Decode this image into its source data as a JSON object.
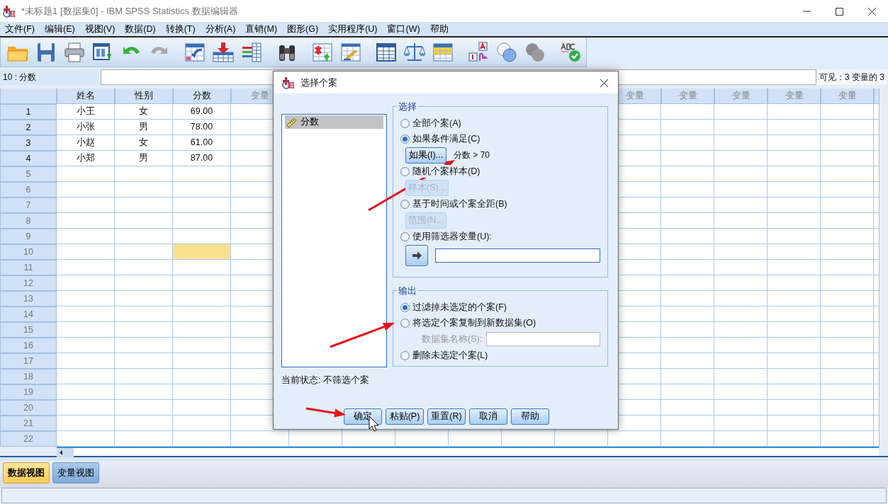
{
  "window": {
    "title": "*未标题1 [数据集0] - IBM SPSS Statistics 数据编辑器"
  },
  "menu": [
    "文件(F)",
    "编辑(E)",
    "视图(V)",
    "数据(D)",
    "转换(T)",
    "分析(A)",
    "直销(M)",
    "图形(G)",
    "实用程序(U)",
    "窗口(W)",
    "帮助"
  ],
  "toolbar": [
    {
      "disabled": false
    },
    {
      "disabled": false
    },
    {
      "disabled": false
    },
    {
      "disabled": false
    },
    {
      "disabled": false
    },
    {
      "disabled": true
    },
    {
      "disabled": false
    },
    {
      "disabled": false
    },
    {
      "disabled": false
    },
    {
      "disabled": false
    },
    {
      "disabled": false
    },
    {
      "disabled": false
    },
    {
      "disabled": false
    },
    {
      "disabled": false
    },
    {
      "disabled": false
    },
    {
      "disabled": false
    },
    {
      "disabled": false
    },
    {
      "disabled": false
    },
    {
      "disabled": false
    }
  ],
  "cell_bar": {
    "cell": "10 : 分数",
    "visible": "可见：3 变量的 3"
  },
  "grid": {
    "columns": [
      "姓名",
      "性别",
      "分数",
      "变量"
    ],
    "columns_right": [
      "变量",
      "变量",
      "变量",
      "变量",
      "变量"
    ],
    "rows": [
      {
        "label": "1",
        "cells": [
          {
            "text": "小王",
            "selected": false
          },
          {
            "text": "女",
            "selected": false
          },
          {
            "text": "69.00",
            "selected": false
          }
        ]
      },
      {
        "label": "2",
        "cells": [
          {
            "text": "小张",
            "selected": false
          },
          {
            "text": "男",
            "selected": false
          },
          {
            "text": "78.00",
            "selected": false
          }
        ]
      },
      {
        "label": "3",
        "cells": [
          {
            "text": "小赵",
            "selected": false
          },
          {
            "text": "女",
            "selected": false
          },
          {
            "text": "61.00",
            "selected": false
          }
        ]
      },
      {
        "label": "4",
        "cells": [
          {
            "text": "小郑",
            "selected": false
          },
          {
            "text": "男",
            "selected": false
          },
          {
            "text": "87.00",
            "selected": false
          }
        ]
      },
      {
        "label": "5",
        "cells": [
          {
            "selected": false
          },
          {
            "selected": false
          },
          {
            "selected": false
          }
        ]
      },
      {
        "label": "6",
        "cells": [
          {
            "selected": false
          },
          {
            "selected": false
          },
          {
            "selected": false
          }
        ]
      },
      {
        "label": "7",
        "cells": [
          {
            "selected": false
          },
          {
            "selected": false
          },
          {
            "selected": false
          }
        ]
      },
      {
        "label": "8",
        "cells": [
          {
            "selected": false
          },
          {
            "selected": false
          },
          {
            "selected": false
          }
        ]
      },
      {
        "label": "9",
        "cells": [
          {
            "selected": false
          },
          {
            "selected": false
          },
          {
            "selected": false
          }
        ]
      },
      {
        "label": "10",
        "cells": [
          {
            "selected": false
          },
          {
            "selected": false
          },
          {
            "selected": true
          }
        ]
      },
      {
        "label": "11",
        "cells": [
          {
            "selected": false
          },
          {
            "selected": false
          },
          {
            "selected": false
          }
        ]
      },
      {
        "label": "12",
        "cells": [
          {
            "selected": false
          },
          {
            "selected": false
          },
          {
            "selected": false
          }
        ]
      },
      {
        "label": "13",
        "cells": [
          {
            "selected": false
          },
          {
            "selected": false
          },
          {
            "selected": false
          }
        ]
      },
      {
        "label": "14",
        "cells": [
          {
            "selected": false
          },
          {
            "selected": false
          },
          {
            "selected": false
          }
        ]
      },
      {
        "label": "15",
        "cells": [
          {
            "selected": false
          },
          {
            "selected": false
          },
          {
            "selected": false
          }
        ]
      },
      {
        "label": "16",
        "cells": [
          {
            "selected": false
          },
          {
            "selected": false
          },
          {
            "selected": false
          }
        ]
      },
      {
        "label": "17",
        "cells": [
          {
            "selected": false
          },
          {
            "selected": false
          },
          {
            "selected": false
          }
        ]
      },
      {
        "label": "18",
        "cells": [
          {
            "selected": false
          },
          {
            "selected": false
          },
          {
            "selected": false
          }
        ]
      },
      {
        "label": "19",
        "cells": [
          {
            "selected": false
          },
          {
            "selected": false
          },
          {
            "selected": false
          }
        ]
      },
      {
        "label": "20",
        "cells": [
          {
            "selected": false
          },
          {
            "selected": false
          },
          {
            "selected": false
          }
        ]
      },
      {
        "label": "21",
        "cells": [
          {
            "selected": false
          },
          {
            "selected": false
          },
          {
            "selected": false
          }
        ]
      },
      {
        "label": "22",
        "cells": [
          {
            "selected": false
          },
          {
            "selected": false
          },
          {
            "selected": false
          }
        ]
      }
    ]
  },
  "dialog": {
    "title": "选择个案",
    "variables": [
      {
        "label": "分数",
        "selected": true
      }
    ],
    "select_group": {
      "legend": "选择",
      "options": [
        {
          "kind": "plain",
          "label": "全部个案(A)",
          "selected": false
        },
        {
          "kind": "button",
          "label": "如果条件满足(C)",
          "selected": true,
          "button": {
            "label": "如果(I)...",
            "disabled": false
          },
          "condition": "分数 > 70"
        },
        {
          "kind": "button",
          "label": "随机个案样本(D)",
          "selected": false,
          "button": {
            "label": "样本(S)...",
            "disabled": true
          }
        },
        {
          "kind": "button",
          "label": "基于时间或个案全距(B)",
          "selected": false,
          "button": {
            "label": "范围(N...",
            "disabled": true
          }
        },
        {
          "kind": "filter",
          "label": "使用筛选器变量(U):",
          "selected": false
        }
      ]
    },
    "output_group": {
      "legend": "输出",
      "options": [
        {
          "kind": "plain",
          "label": "过滤掉未选定的个案(F)",
          "selected": true
        },
        {
          "kind": "dataset",
          "label": "将选定个案复制到新数据集(O)",
          "selected": false,
          "field_label": "数据集名称(S):",
          "disabled": true
        },
        {
          "kind": "plain",
          "label": "删除未选定个案(L)",
          "selected": false
        }
      ]
    },
    "status": "当前状态: 不筛选个案",
    "buttons": [
      "确定",
      "粘贴(P)",
      "重置(R)",
      "取消",
      "帮助"
    ]
  },
  "view_tabs": [
    {
      "label": "数据视图",
      "selected": true
    },
    {
      "label": "变量视图",
      "selected": false
    }
  ]
}
